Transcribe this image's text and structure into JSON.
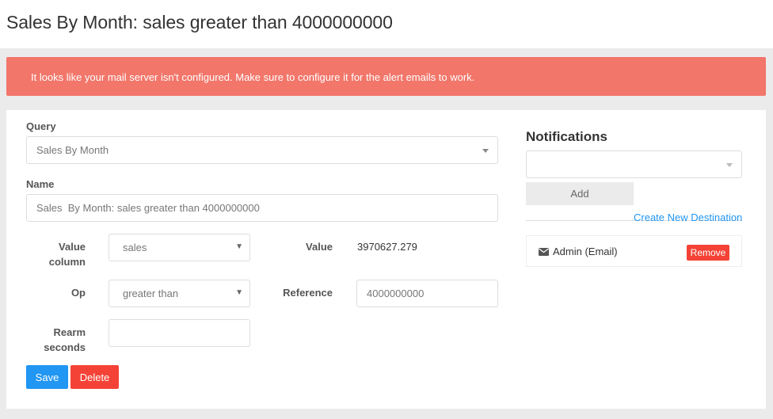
{
  "header": {
    "title": "Sales By Month: sales greater than 4000000000"
  },
  "alert": {
    "text": "It looks like your mail server isn't configured. Make sure to configure it for the alert emails to work."
  },
  "form": {
    "query_label": "Query",
    "query_value": "Sales By Month",
    "name_label": "Name",
    "name_value": "Sales  By Month: sales greater than 4000000000",
    "value_column_label_1": "Value",
    "value_column_label_2": "column",
    "value_column_value": "sales",
    "value_label": "Value",
    "value_value": "3970627.279",
    "op_label": "Op",
    "op_value": "greater than",
    "reference_label": "Reference",
    "reference_value": "4000000000",
    "rearm_label_1": "Rearm",
    "rearm_label_2": "seconds",
    "rearm_value": "",
    "save_label": "Save",
    "delete_label": "Delete"
  },
  "notifications": {
    "title": "Notifications",
    "select_value": "",
    "add_label": "Add",
    "create_link": "Create New Destination",
    "destinations": [
      {
        "label": "Admin (Email)",
        "remove_label": "Remove",
        "icon": "envelope-icon"
      }
    ]
  },
  "colors": {
    "alert_bg": "#f2766a",
    "save_btn": "#2196f3",
    "delete_btn": "#f44336",
    "link": "#2196f3"
  }
}
